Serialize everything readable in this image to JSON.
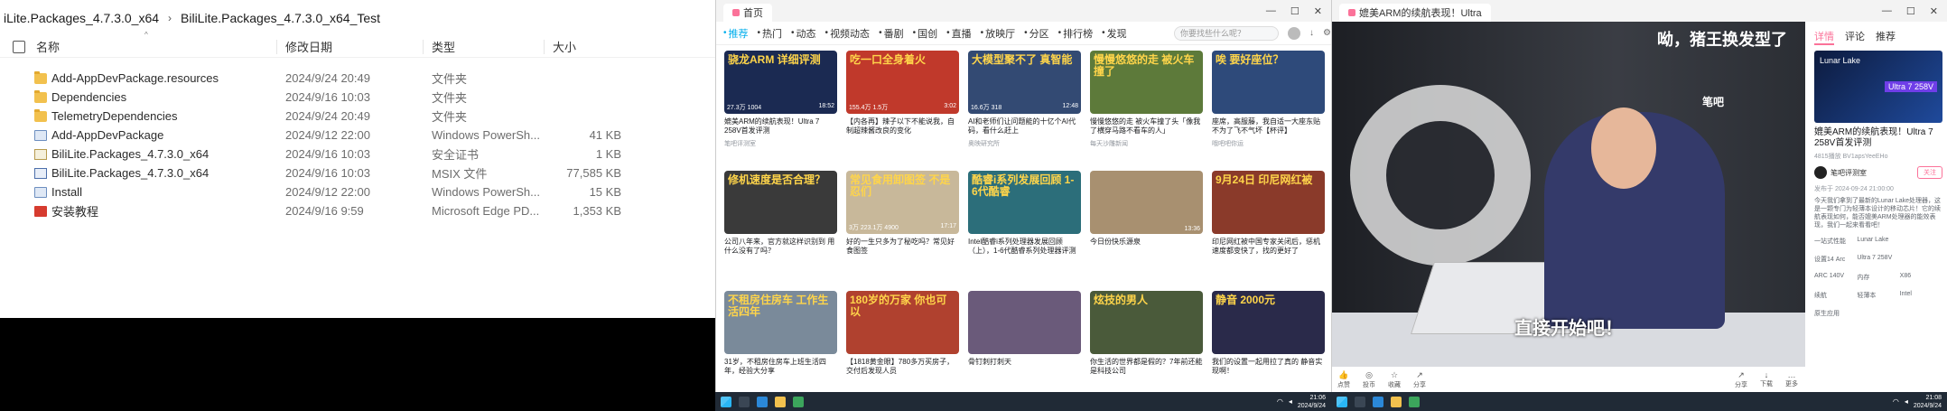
{
  "explorer": {
    "breadcrumb": [
      "iLite.Packages_4.7.3.0_x64",
      "BiliLite.Packages_4.7.3.0_x64_Test"
    ],
    "columns": {
      "name": "名称",
      "date": "修改日期",
      "type": "类型",
      "size": "大小"
    },
    "files": [
      {
        "name": "Add-AppDevPackage.resources",
        "date": "2024/9/24 20:49",
        "type": "文件夹",
        "size": "",
        "icon": "folder-icon"
      },
      {
        "name": "Dependencies",
        "date": "2024/9/16 10:03",
        "type": "文件夹",
        "size": "",
        "icon": "folder-icon"
      },
      {
        "name": "TelemetryDependencies",
        "date": "2024/9/24 20:49",
        "type": "文件夹",
        "size": "",
        "icon": "folder-icon"
      },
      {
        "name": "Add-AppDevPackage",
        "date": "2024/9/12 22:00",
        "type": "Windows PowerSh...",
        "size": "41 KB",
        "icon": "powershell-script-icon"
      },
      {
        "name": "BiliLite.Packages_4.7.3.0_x64",
        "date": "2024/9/16 10:03",
        "type": "安全证书",
        "size": "1 KB",
        "icon": "certificate-icon"
      },
      {
        "name": "BiliLite.Packages_4.7.3.0_x64",
        "date": "2024/9/16 10:03",
        "type": "MSIX 文件",
        "size": "77,585 KB",
        "icon": "msix-package-icon"
      },
      {
        "name": "Install",
        "date": "2024/9/12 22:00",
        "type": "Windows PowerSh...",
        "size": "15 KB",
        "icon": "powershell-script-icon"
      },
      {
        "name": "安装教程",
        "date": "2024/9/16 9:59",
        "type": "Microsoft Edge PD...",
        "size": "1,353 KB",
        "icon": "pdf-icon"
      }
    ]
  },
  "browser": {
    "tab_title": "首页",
    "nav": [
      "推荐",
      "热门",
      "动态",
      "视频动态",
      "番剧",
      "国创",
      "直播",
      "放映厅",
      "分区",
      "排行榜",
      "发现"
    ],
    "search_placeholder": "你要找些什么呢？",
    "cards": [
      {
        "thumb_text": "骁龙ARM 详细评测",
        "meta_left": "27.3万 1004",
        "meta_right": "18:52",
        "title": "媲美ARM的续航表现！Ultra 7 258V首发评测",
        "up": "笔吧评测室",
        "color": "#1b2a52"
      },
      {
        "thumb_text": "吃一口全身着火",
        "meta_left": "155.4万 1.5万",
        "meta_right": "3:02",
        "title": "【内各再】辣子以下不能说我，自制超辣酱改良的变化",
        "up": "",
        "color": "#c0392b"
      },
      {
        "thumb_text": "大模型聚不了 真智能",
        "meta_left": "16.6万 318",
        "meta_right": "12:48",
        "title": "AI和老师们让问题能的十亿个AI代码，看什么赶上",
        "up": "奥映研究所",
        "color": "#334a73"
      },
      {
        "thumb_text": "慢慢悠悠的走 被火车撞了",
        "meta_left": "",
        "meta_right": "",
        "title": "慢慢悠悠的走 被火车撞了头「像我了横穿马路不看车的人」",
        "up": "每天沙雕新闻",
        "color": "#5d7a3a"
      },
      {
        "thumb_text": "唉 要好座位？",
        "meta_left": "",
        "meta_right": "",
        "title": "座席，高服藤，我自适一大座东贴不为了飞不气坏【杯评】",
        "up": "哦吧吧你运",
        "color": "#2e4a7a"
      },
      {
        "thumb_text": "修机速度是否合理？",
        "meta_left": "",
        "meta_right": "",
        "title": "公司八年来，官方就这样识别到 用什么没有了吗？",
        "up": "",
        "color": "#3a3a3a"
      },
      {
        "thumb_text": "常见食用卸图签 不是 忍们",
        "meta_left": "3万 223.1万 4900",
        "meta_right": "17:17",
        "title": "好的一生只多为了秘吃吗？常见好食图签",
        "up": "",
        "color": "#c8b89a"
      },
      {
        "thumb_text": "酷睿i系列发展回顾 1-6代酷睿",
        "meta_left": "",
        "meta_right": "",
        "title": "Intel酷睿i系列处理器发展回顾（上），1-6代酷睿系列处理器评测",
        "up": "",
        "color": "#2c6e7a"
      },
      {
        "thumb_text": "",
        "meta_left": "",
        "meta_right": "13:36",
        "title": "今日份快乐源泉",
        "up": "",
        "color": "#a89070"
      },
      {
        "thumb_text": "9月24日 印尼网红被",
        "meta_left": "",
        "meta_right": "",
        "title": "印尼网红被中国专家关闭后，惩机速度都变快了，找的更好了",
        "up": "",
        "color": "#8a3a2a"
      },
      {
        "thumb_text": "不租房住房车 工作生活四年",
        "meta_left": "",
        "meta_right": "",
        "title": "31岁，不租房住房车上班生活四年，经验大分享",
        "up": "",
        "color": "#7a8a9a"
      },
      {
        "thumb_text": "180岁的万家 你也可以",
        "meta_left": "",
        "meta_right": "",
        "title": "【1818黄金眼】780多万买房子，交付后发现人员",
        "up": "",
        "color": "#b0412f"
      },
      {
        "thumb_text": "",
        "meta_left": "",
        "meta_right": "",
        "title": "骨钉刺打刺天",
        "up": "",
        "color": "#6a5a7a"
      },
      {
        "thumb_text": "炫技的男人",
        "meta_left": "",
        "meta_right": "",
        "title": "你生活的世界都是假的？7年前还能是科技公司",
        "up": "",
        "color": "#4a5a3a"
      },
      {
        "thumb_text": "静音 2000元",
        "meta_left": "",
        "meta_right": "",
        "title": "我们的设置一起用拉了真的 静音实现啊！",
        "up": "",
        "color": "#2a2a4a"
      }
    ]
  },
  "player": {
    "tab_title": "媲美ARM的续航表现！Ultra",
    "top_caption": "呦，猪王换发型了",
    "subtitle": "直接开始吧！",
    "channel_badge": "笔吧",
    "side_tabs": [
      "详情",
      "评论",
      "推荐"
    ],
    "thumb_line1": "Lunar Lake",
    "thumb_line2": "Ultra 7 258V",
    "video_title": "媲美ARM的续航表现！Ultra 7 258V首发评测",
    "stats": "4815播放 BV1apsYeeEHo",
    "uploader": "笔吧评测室",
    "follow_label": "关注",
    "publish_time": "发布于 2024-09-24 21:00:00",
    "description": "今天我们拿到了最新的Lunar Lake处理器，这是一颗专门为轻薄本设计的移动芯片！它的续航表现如何，能否媲美ARM处理器的能效表现，我们一起来看看吧！",
    "specs": [
      "一站式性能",
      "Lunar Lake",
      "",
      "设置14 Arc",
      "Ultra 7 258V",
      "",
      "ARC 140V",
      "内存",
      "X86",
      "续航",
      "轻薄本",
      "Intel",
      "原生应用",
      "",
      ""
    ],
    "controls": [
      "点赞",
      "投币",
      "收藏",
      "分享"
    ],
    "controls_right": [
      "分享",
      "下载",
      "更多"
    ]
  },
  "taskbar": {
    "time1": "21:06",
    "date1": "2024/9/24",
    "time2": "21:08",
    "date2": "2024/9/24"
  }
}
